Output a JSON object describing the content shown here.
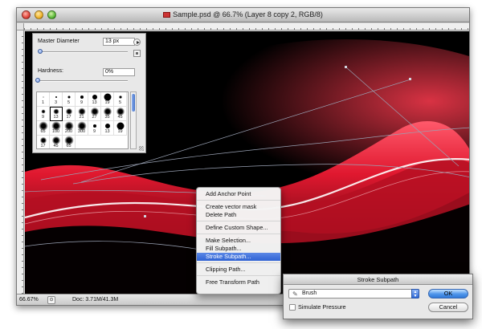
{
  "window": {
    "title": "Sample.psd @ 66.7% (Layer 8 copy 2, RGB/8)",
    "status": {
      "zoom": "66.67%",
      "doc_size": "Doc: 3.71M/41.3M"
    }
  },
  "brush_panel": {
    "master_diameter_label": "Master Diameter",
    "master_diameter_value": "13 px",
    "master_diameter_level": 0.03,
    "hardness_label": "Hardness:",
    "hardness_value": "0%",
    "hardness_level": 0.0,
    "brushes": [
      {
        "size": "1",
        "kind": "hard",
        "d": 1
      },
      {
        "size": "3",
        "kind": "hard",
        "d": 2
      },
      {
        "size": "5",
        "kind": "hard",
        "d": 3
      },
      {
        "size": "9",
        "kind": "hard",
        "d": 4
      },
      {
        "size": "13",
        "kind": "hard",
        "d": 6
      },
      {
        "size": "19",
        "kind": "hard",
        "d": 9
      },
      {
        "size": "5",
        "kind": "soft",
        "d": 4
      },
      {
        "size": "9",
        "kind": "soft",
        "d": 5
      },
      {
        "size": "13",
        "kind": "soft",
        "d": 7,
        "selected": true
      },
      {
        "size": "17",
        "kind": "soft",
        "d": 8
      },
      {
        "size": "21",
        "kind": "soft",
        "d": 9
      },
      {
        "size": "27",
        "kind": "soft",
        "d": 10
      },
      {
        "size": "35",
        "kind": "soft",
        "d": 10
      },
      {
        "size": "45",
        "kind": "soft",
        "d": 10
      },
      {
        "size": "65",
        "kind": "soft",
        "d": 11
      },
      {
        "size": "100",
        "kind": "soft",
        "d": 11
      },
      {
        "size": "200",
        "kind": "soft",
        "d": 11
      },
      {
        "size": "300",
        "kind": "soft",
        "d": 11
      },
      {
        "size": "9",
        "kind": "hard",
        "d": 4
      },
      {
        "size": "13",
        "kind": "hard",
        "d": 6
      },
      {
        "size": "19",
        "kind": "hard",
        "d": 9
      },
      {
        "size": "17",
        "kind": "soft",
        "d": 8
      },
      {
        "size": "45",
        "kind": "soft",
        "d": 10
      },
      {
        "size": "65",
        "kind": "soft",
        "d": 11
      }
    ]
  },
  "context_menu": {
    "items": [
      {
        "label": "Add Anchor Point"
      },
      {
        "sep": true
      },
      {
        "label": "Create vector mask"
      },
      {
        "label": "Delete Path"
      },
      {
        "sep": true
      },
      {
        "label": "Define Custom Shape..."
      },
      {
        "sep": true
      },
      {
        "label": "Make Selection..."
      },
      {
        "label": "Fill Subpath..."
      },
      {
        "label": "Stroke Subpath...",
        "highlighted": true
      },
      {
        "sep": true
      },
      {
        "label": "Clipping Path..."
      },
      {
        "sep": true
      },
      {
        "label": "Free Transform Path"
      }
    ]
  },
  "dialog": {
    "title": "Stroke Subpath",
    "tool": "Brush",
    "simulate_pressure_label": "Simulate Pressure",
    "simulate_pressure_checked": false,
    "ok_label": "OK",
    "cancel_label": "Cancel"
  },
  "colors": {
    "canvas_bg": "#000000",
    "wave_red": "#e0182f",
    "path_line": "#9aa2b4",
    "menu_highlight": "#3a6fd8"
  }
}
